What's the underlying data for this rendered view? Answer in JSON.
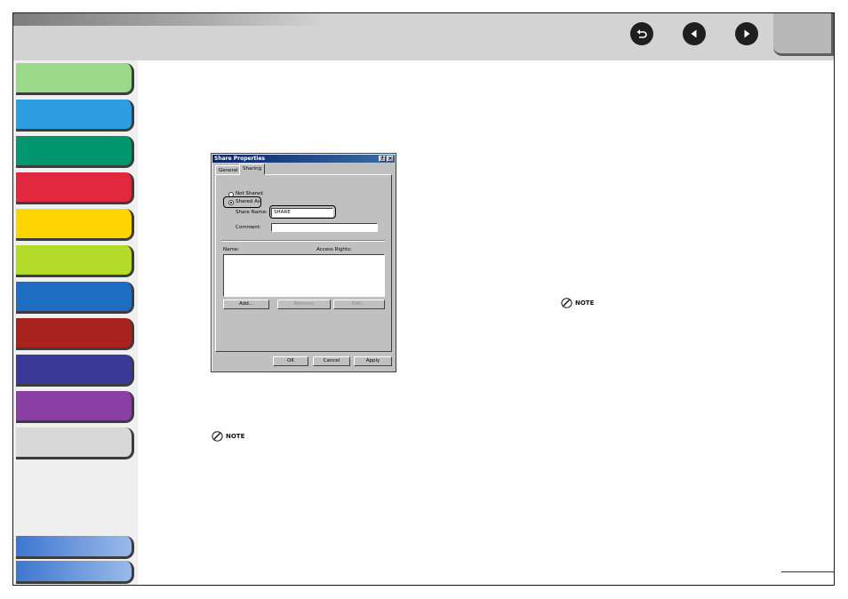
{
  "nav": {
    "buttons": [
      {
        "icon": "back-icon"
      },
      {
        "icon": "previous-page-icon"
      },
      {
        "icon": "next-page-icon"
      }
    ]
  },
  "sidebar": {
    "tab_colors": [
      "#9ad98a",
      "#2d9fe0",
      "#00966e",
      "#e2283c",
      "#ffd500",
      "#b3dc2a",
      "#1d6ec3",
      "#a8221e",
      "#3a3997",
      "#8a3fa5",
      "#d8d8d8"
    ],
    "bottom_tab_colors": [
      "#5f92dd",
      "#5f92dd"
    ]
  },
  "dialog": {
    "title": "Share Properties",
    "help_btn": "?",
    "close_btn": "×",
    "tabs": [
      "General",
      "Sharing"
    ],
    "not_shared": "Not Shared",
    "shared_as": "Shared As:",
    "share_name_label": "Share Name:",
    "share_name_value": "SHARE",
    "comment_label": "Comment:",
    "comment_value": "",
    "col_name": "Name:",
    "col_access": "Access Rights:",
    "btn_add": "Add...",
    "btn_remove": "Remove",
    "btn_edit": "Edit...",
    "btn_ok": "OK",
    "btn_cancel": "Cancel",
    "btn_apply": "Apply"
  },
  "notes": {
    "left": "NOTE",
    "right": "NOTE"
  }
}
